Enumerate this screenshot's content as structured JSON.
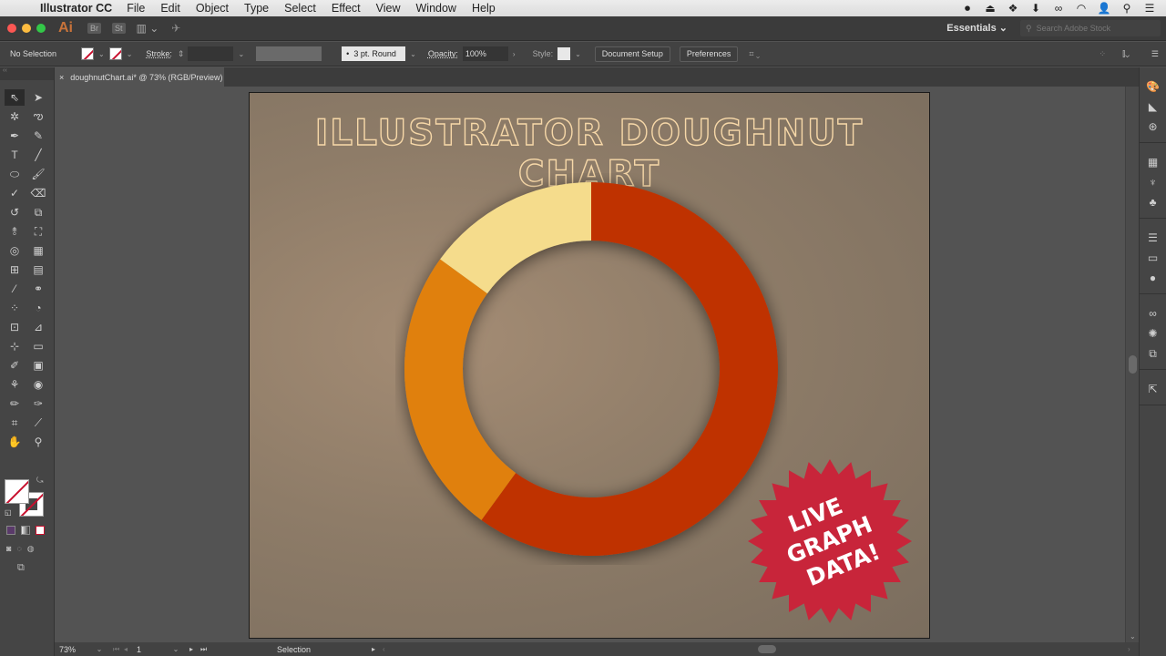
{
  "menubar": {
    "apple_icon": "apple-icon",
    "app_name": "Illustrator CC",
    "items": [
      "File",
      "Edit",
      "Object",
      "Type",
      "Select",
      "Effect",
      "View",
      "Window",
      "Help"
    ],
    "status_icons": [
      "screen-record-icon",
      "airplay-icon",
      "dropbox-icon",
      "download-icon",
      "creative-cloud-icon",
      "wifi-icon",
      "user-icon",
      "spotlight-search-icon",
      "notification-list-icon"
    ]
  },
  "appbar": {
    "logo": "Ai",
    "bridge": "Br",
    "stock": "St",
    "workspace": "Essentials",
    "stock_search_placeholder": "Search Adobe Stock"
  },
  "control_bar": {
    "selection": "No Selection",
    "stroke_label": "Stroke:",
    "brush": "3 pt. Round",
    "opacity_label": "Opacity:",
    "opacity_value": "100%",
    "style_label": "Style:",
    "document_setup": "Document Setup",
    "preferences": "Preferences"
  },
  "document_tab": {
    "close": "×",
    "title": "doughnutChart.ai* @ 73% (RGB/Preview)"
  },
  "tools": [
    "selection-tool",
    "direct-selection-tool",
    "magic-wand-tool",
    "lasso-tool",
    "pen-tool",
    "curvature-tool",
    "type-tool",
    "line-segment-tool",
    "ellipse-tool",
    "paintbrush-tool",
    "shaper-tool",
    "eraser-tool",
    "rotate-tool",
    "scale-tool",
    "width-tool",
    "free-transform-tool",
    "shape-builder-tool",
    "perspective-grid-tool",
    "mesh-tool",
    "gradient-tool",
    "eyedropper-tool",
    "blend-tool",
    "symbol-sprayer-tool",
    "pie-graph-tool",
    "artboard-tool",
    "slice-tool",
    "puppet-warp-tool",
    "ruler-tool",
    "paint-bucket-tool",
    "gradient-panel-tool",
    "warp-tool",
    "symbol-tool",
    "pencil-tool",
    "blob-brush-tool",
    "crop-tool",
    "knife-tool",
    "hand-tool",
    "zoom-tool"
  ],
  "artwork": {
    "title": "ILLUSTRATOR DOUGHNUT CHART",
    "badge_lines": [
      "LIVE",
      "GRAPH",
      "DATA!"
    ],
    "badge_color": "#c8253a",
    "title_stroke_color": "#f7d8a8"
  },
  "chart_data": {
    "type": "pie",
    "variant": "doughnut",
    "title": "ILLUSTRATOR DOUGHNUT CHART",
    "categories": [
      "Red",
      "Orange",
      "Yellow"
    ],
    "values": [
      60,
      25,
      15
    ],
    "colors": [
      "#bf3300",
      "#e0800f",
      "#f5dc8c"
    ],
    "start_angle": "top",
    "direction": "clockwise",
    "legend": "none"
  },
  "statusbar": {
    "zoom": "73%",
    "page": "1",
    "tool": "Selection"
  },
  "right_dock": [
    [
      "color-guide-icon",
      "gradient-icon",
      "appearance-icon"
    ],
    [
      "swatches-icon",
      "brushes-icon",
      "symbols-icon"
    ],
    [
      "stroke-icon",
      "transparency-icon",
      "color-icon"
    ],
    [
      "cc-libraries-icon",
      "graphic-styles-icon",
      "layers-icon"
    ],
    [
      "export-icon"
    ]
  ]
}
